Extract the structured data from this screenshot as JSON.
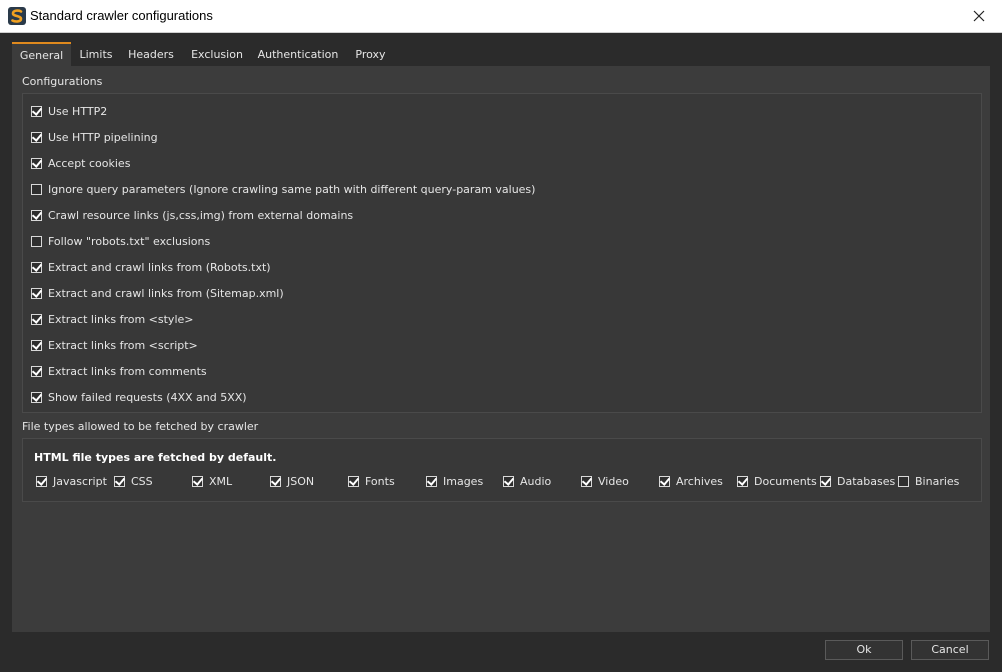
{
  "window": {
    "title": "Standard crawler configurations",
    "icon": "app-logo-icon"
  },
  "tabs": [
    {
      "label": "General",
      "active": true
    },
    {
      "label": "Limits",
      "active": false
    },
    {
      "label": "Headers",
      "active": false
    },
    {
      "label": "Exclusion",
      "active": false
    },
    {
      "label": "Authentication",
      "active": false
    },
    {
      "label": "Proxy",
      "active": false
    }
  ],
  "configurations": {
    "title": "Configurations",
    "options": [
      {
        "label": "Use HTTP2",
        "checked": true
      },
      {
        "label": "Use HTTP pipelining",
        "checked": true
      },
      {
        "label": "Accept cookies",
        "checked": true
      },
      {
        "label": "Ignore query parameters (Ignore crawling same path with different query-param values)",
        "checked": false
      },
      {
        "label": "Crawl resource links (js,css,img) from external domains",
        "checked": true
      },
      {
        "label": "Follow \"robots.txt\" exclusions",
        "checked": false
      },
      {
        "label": "Extract and crawl links from (Robots.txt)",
        "checked": true
      },
      {
        "label": "Extract and crawl links from (Sitemap.xml)",
        "checked": true
      },
      {
        "label": "Extract links from <style>",
        "checked": true
      },
      {
        "label": "Extract links from <script>",
        "checked": true
      },
      {
        "label": "Extract links from comments",
        "checked": true
      },
      {
        "label": "Show failed requests (4XX and 5XX)",
        "checked": true
      }
    ]
  },
  "file_types": {
    "title": "File types allowed to be fetched by crawler",
    "note": "HTML file types are fetched by default.",
    "items": [
      {
        "label": "Javascript",
        "checked": true
      },
      {
        "label": "CSS",
        "checked": true
      },
      {
        "label": "XML",
        "checked": true
      },
      {
        "label": "JSON",
        "checked": true
      },
      {
        "label": "Fonts",
        "checked": true
      },
      {
        "label": "Images",
        "checked": true
      },
      {
        "label": "Audio",
        "checked": true
      },
      {
        "label": "Video",
        "checked": true
      },
      {
        "label": "Archives",
        "checked": true
      },
      {
        "label": "Documents",
        "checked": true
      },
      {
        "label": "Databases",
        "checked": true
      },
      {
        "label": "Binaries",
        "checked": false
      }
    ]
  },
  "buttons": {
    "ok": "Ok",
    "cancel": "Cancel"
  },
  "colors": {
    "accent": "#e08a1e",
    "background": "#2b2b2b",
    "panel": "#3c3c3c"
  }
}
